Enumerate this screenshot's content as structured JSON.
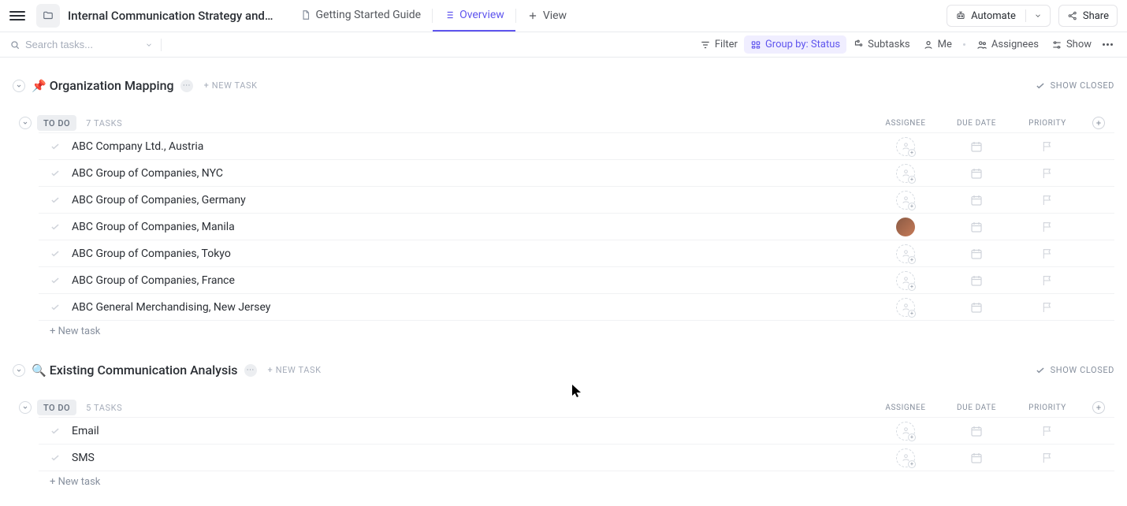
{
  "header": {
    "page_title": "Internal Communication Strategy and…",
    "tabs": [
      {
        "label": "Getting Started Guide"
      },
      {
        "label": "Overview"
      }
    ],
    "add_view": "View",
    "automate": "Automate",
    "share": "Share"
  },
  "subheader": {
    "search_placeholder": "Search tasks...",
    "filter": "Filter",
    "group_by": "Group by: Status",
    "subtasks": "Subtasks",
    "me": "Me",
    "assignees": "Assignees",
    "show": "Show"
  },
  "lists": [
    {
      "emoji": "📌",
      "title": "Organization Mapping",
      "new_task_label": "+ NEW TASK",
      "show_closed": "SHOW CLOSED",
      "groups": [
        {
          "status": "TO DO",
          "task_count": "7 TASKS",
          "columns": {
            "assignee": "ASSIGNEE",
            "due_date": "DUE DATE",
            "priority": "PRIORITY"
          },
          "tasks": [
            {
              "name": "ABC Company Ltd., Austria",
              "assignee": null
            },
            {
              "name": "ABC Group of Companies, NYC",
              "assignee": null
            },
            {
              "name": "ABC Group of Companies, Germany",
              "assignee": null
            },
            {
              "name": "ABC Group of Companies, Manila",
              "assignee": "avatar"
            },
            {
              "name": "ABC Group of Companies, Tokyo",
              "assignee": null
            },
            {
              "name": "ABC Group of Companies, France",
              "assignee": null
            },
            {
              "name": "ABC General Merchandising, New Jersey",
              "assignee": null
            }
          ],
          "new_task_row": "+ New task"
        }
      ]
    },
    {
      "emoji": "🔍",
      "title": "Existing Communication Analysis",
      "new_task_label": "+ NEW TASK",
      "show_closed": "SHOW CLOSED",
      "groups": [
        {
          "status": "TO DO",
          "task_count": "5 TASKS",
          "columns": {
            "assignee": "ASSIGNEE",
            "due_date": "DUE DATE",
            "priority": "PRIORITY"
          },
          "tasks": [
            {
              "name": "Email",
              "assignee": null
            },
            {
              "name": "SMS",
              "assignee": null
            }
          ],
          "new_task_row": "+ New task"
        }
      ]
    }
  ]
}
